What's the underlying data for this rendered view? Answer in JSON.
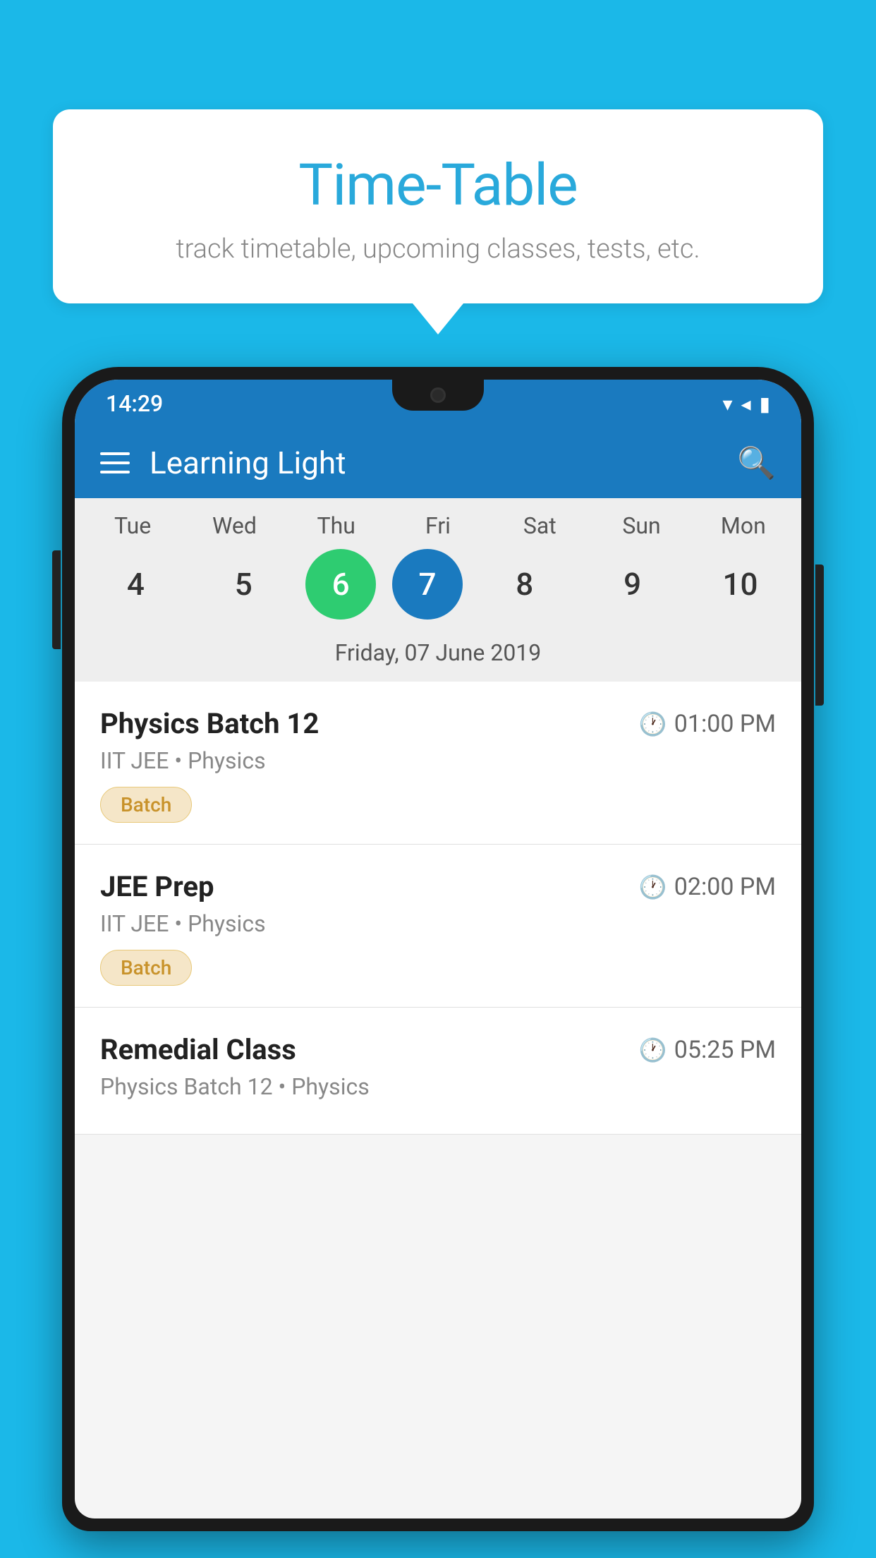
{
  "background": {
    "color": "#1bb8e8"
  },
  "speech_bubble": {
    "title": "Time-Table",
    "subtitle": "track timetable, upcoming classes, tests, etc."
  },
  "phone": {
    "status_bar": {
      "time": "14:29"
    },
    "app_bar": {
      "title": "Learning Light"
    },
    "calendar": {
      "days": [
        "Tue",
        "Wed",
        "Thu",
        "Fri",
        "Sat",
        "Sun",
        "Mon"
      ],
      "dates": [
        "4",
        "5",
        "6",
        "7",
        "8",
        "9",
        "10"
      ],
      "today_index": 2,
      "selected_index": 3,
      "selected_date_label": "Friday, 07 June 2019"
    },
    "schedule": [
      {
        "title": "Physics Batch 12",
        "time": "01:00 PM",
        "subtitle": "IIT JEE • Physics",
        "badge": "Batch"
      },
      {
        "title": "JEE Prep",
        "time": "02:00 PM",
        "subtitle": "IIT JEE • Physics",
        "badge": "Batch"
      },
      {
        "title": "Remedial Class",
        "time": "05:25 PM",
        "subtitle": "Physics Batch 12 • Physics",
        "badge": ""
      }
    ]
  }
}
